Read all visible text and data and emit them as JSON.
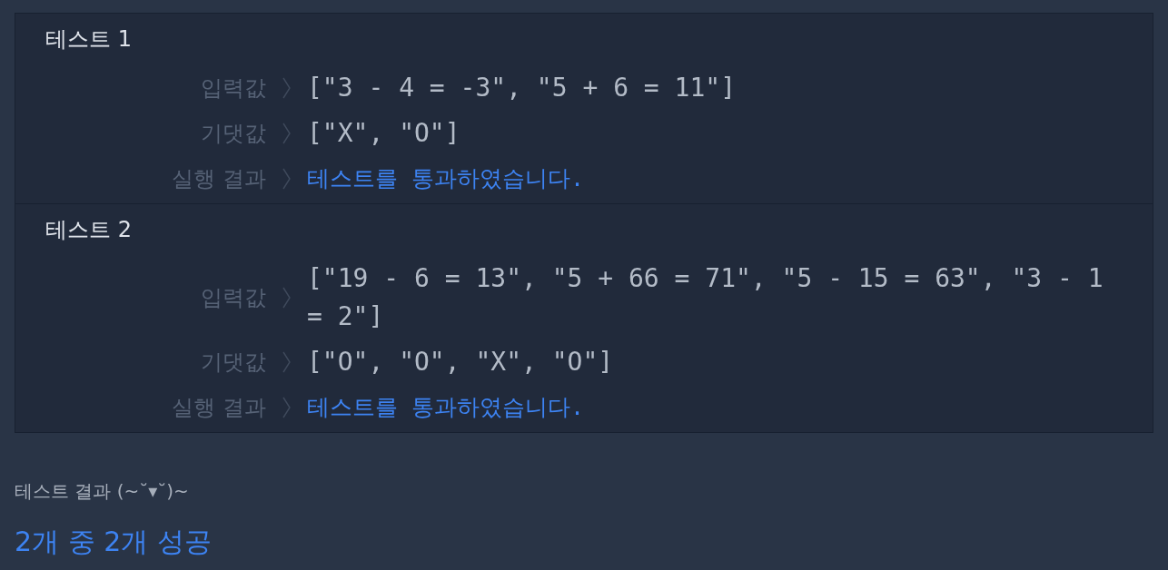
{
  "tests": [
    {
      "title": "테스트 1",
      "rows": [
        {
          "label": "입력값",
          "kind": "code",
          "value": "[\"3 - 4 = -3\", \"5 + 6 = 11\"]"
        },
        {
          "label": "기댓값",
          "kind": "code",
          "value": "[\"X\", \"O\"]"
        },
        {
          "label": "실행 결과",
          "kind": "result",
          "value": "테스트를 통과하였습니다."
        }
      ]
    },
    {
      "title": "테스트 2",
      "rows": [
        {
          "label": "입력값",
          "kind": "code",
          "value": "[\"19 - 6 = 13\", \"5 + 66 = 71\", \"5 - 15 = 63\", \"3 - 1 = 2\"]"
        },
        {
          "label": "기댓값",
          "kind": "code",
          "value": "[\"O\", \"O\", \"X\", \"O\"]"
        },
        {
          "label": "실행 결과",
          "kind": "result",
          "value": "테스트를 통과하였습니다."
        }
      ]
    }
  ],
  "summary": {
    "heading": "테스트 결과 (~˘▾˘)~",
    "result": "2개 중 2개 성공"
  }
}
